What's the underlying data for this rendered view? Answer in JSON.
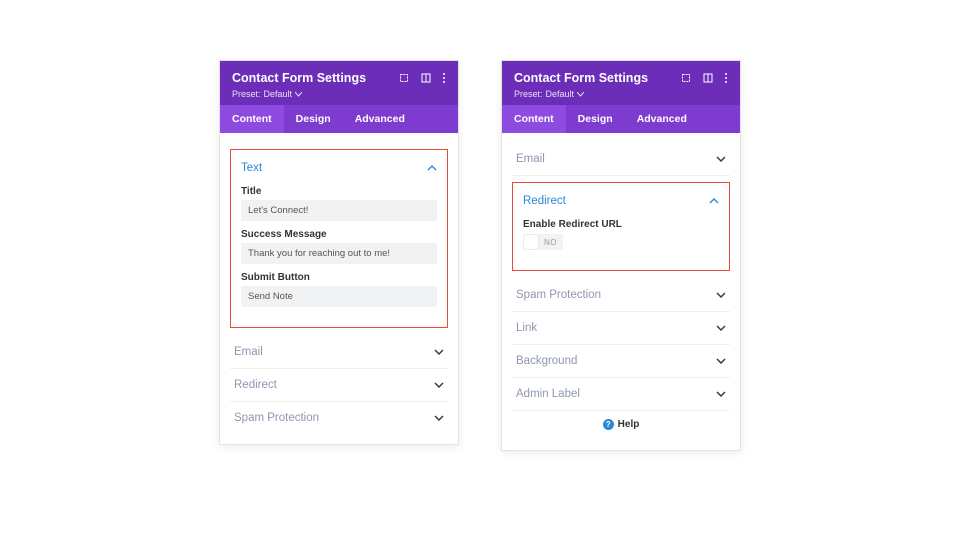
{
  "header": {
    "title": "Contact Form Settings",
    "preset_prefix": "Preset:",
    "preset_value": "Default"
  },
  "tabs": {
    "content": "Content",
    "design": "Design",
    "advanced": "Advanced"
  },
  "left": {
    "text_section": {
      "title": "Text",
      "title_label": "Title",
      "title_value": "Let's Connect!",
      "success_label": "Success Message",
      "success_value": "Thank you for reaching out to me!",
      "submit_label": "Submit Button",
      "submit_value": "Send Note"
    },
    "email_section": "Email",
    "redirect_section": "Redirect",
    "spam_section": "Spam Protection"
  },
  "right": {
    "email_section": "Email",
    "redirect_section": {
      "title": "Redirect",
      "enable_label": "Enable Redirect URL",
      "toggle_state": "NO"
    },
    "spam_section": "Spam Protection",
    "link_section": "Link",
    "background_section": "Background",
    "admin_label_section": "Admin Label",
    "help": "Help"
  }
}
